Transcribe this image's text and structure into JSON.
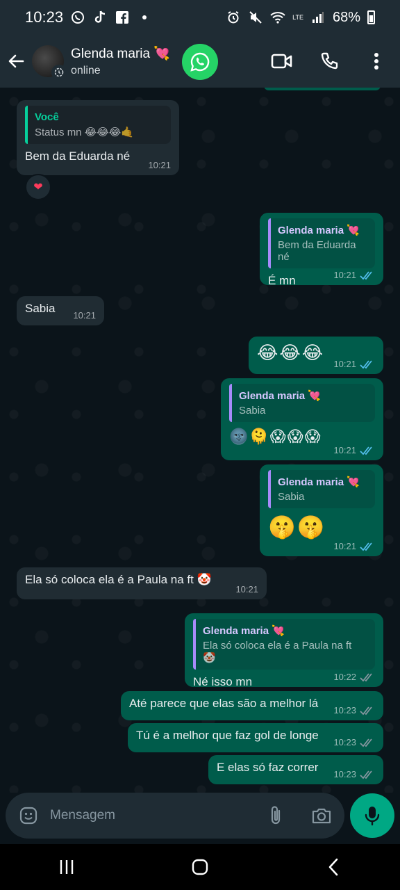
{
  "status_bar": {
    "time": "10:23",
    "battery": "68%",
    "network": "LTE"
  },
  "header": {
    "contact_name": "Glenda maria 💘",
    "presence": "online"
  },
  "messages": [
    {
      "id": "m1",
      "dir": "in",
      "quote_name": "Você",
      "quote_text": "Status mn 😂😂😂🤙",
      "text": "Bem da Eduarda né",
      "time": "10:21",
      "reaction": "❤"
    },
    {
      "id": "m2",
      "dir": "out",
      "quote_name": "Glenda maria 💘",
      "quote_text": "Bem da Eduarda né",
      "text": "É mn",
      "time": "10:21"
    },
    {
      "id": "m3",
      "dir": "in",
      "text": "Sabia",
      "time": "10:21"
    },
    {
      "id": "m4",
      "dir": "out",
      "text": "😂😂😂",
      "time": "10:21"
    },
    {
      "id": "m5",
      "dir": "out",
      "quote_name": "Glenda maria 💘",
      "quote_text": "Sabia",
      "text": "🌚🫠😱😱😱",
      "time": "10:21"
    },
    {
      "id": "m6",
      "dir": "out",
      "quote_name": "Glenda maria 💘",
      "quote_text": "Sabia",
      "text": "🤫🤫",
      "time": "10:21"
    },
    {
      "id": "m7",
      "dir": "in",
      "text": "Ela só coloca ela é a Paula na ft 🤡",
      "time": "10:21"
    },
    {
      "id": "m8",
      "dir": "out",
      "quote_name": "Glenda maria 💘",
      "quote_text": "Ela só coloca ela é a Paula na ft 🤡",
      "text": "Né isso mn",
      "time": "10:22"
    },
    {
      "id": "m9",
      "dir": "out",
      "text": "Até parece que elas são a melhor lá",
      "time": "10:23"
    },
    {
      "id": "m10",
      "dir": "out",
      "text": "Tú é a melhor que faz gol de longe",
      "time": "10:23"
    },
    {
      "id": "m11",
      "dir": "out",
      "text": "E elas só faz correr",
      "time": "10:23"
    }
  ],
  "composer": {
    "placeholder": "Mensagem"
  },
  "colors": {
    "incoming": "#202c33",
    "outgoing": "#005c4b",
    "accent": "#00a884",
    "read_ticks": "#53bdeb",
    "sent_ticks": "#8696a0"
  },
  "icons": [
    "back-arrow-icon",
    "whatsapp-icon",
    "video-call-icon",
    "phone-icon",
    "more-vert-icon",
    "emoji-icon",
    "attach-icon",
    "camera-icon",
    "mic-icon",
    "recents-icon",
    "home-icon",
    "nav-back-icon"
  ]
}
